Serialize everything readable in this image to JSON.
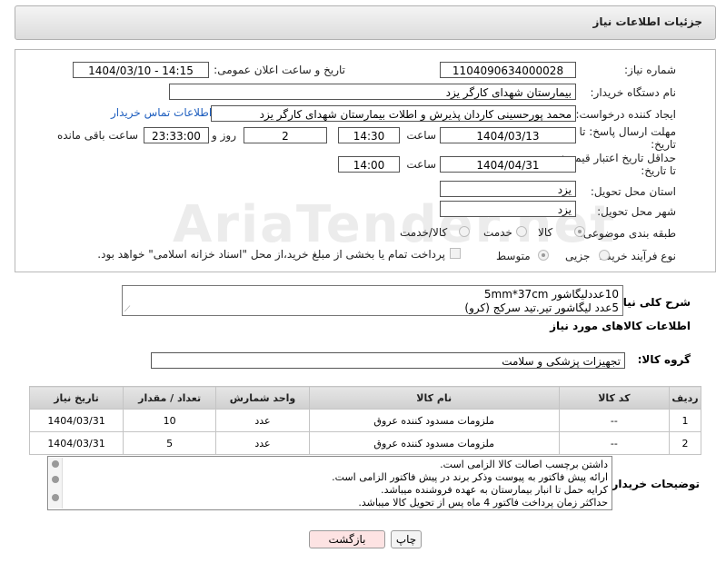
{
  "header": {
    "title": "جزئیات اطلاعات نیاز"
  },
  "watermark": {
    "text": "AriaTender.net"
  },
  "fields": {
    "need_number": {
      "label": "شماره نیاز:",
      "value": "1104090634000028"
    },
    "announce": {
      "label": "تاریخ و ساعت اعلان عمومی:",
      "value": "1404/03/10 - 14:15"
    },
    "buyer_org": {
      "label": "نام دستگاه خریدار:",
      "value": "بیمارستان شهدای کارگر یزد"
    },
    "requester": {
      "label": "ایجاد کننده درخواست:",
      "value": "محمد پورحسینی کاردان پذیرش و اطلات بیمارستان شهدای کارگر یزد",
      "contact_link": "اطلاعات تماس خریدار"
    },
    "reply_deadline": {
      "label_line1": "مهلت ارسال پاسخ: تا",
      "label_line2": "تاریخ:",
      "date": "1404/03/13",
      "time_label": "ساعت",
      "time": "14:30",
      "days": "2",
      "days_label": "روز و",
      "remaining": "23:33:00",
      "remaining_label": "ساعت باقی مانده"
    },
    "price_validity": {
      "label_line1": "حداقل تاریخ اعتبار قیمت:",
      "label_line2": "تا تاریخ:",
      "date": "1404/04/31",
      "time_label": "ساعت",
      "time": "14:00"
    },
    "delivery_province": {
      "label": "استان محل تحویل:",
      "value": "یزد"
    },
    "delivery_city": {
      "label": "شهر محل تحویل:",
      "value": "یزد"
    },
    "category": {
      "label": "طبقه بندی موضوعی:",
      "options": [
        "کالا",
        "خدمت",
        "کالا/خدمت"
      ],
      "selected": "کالا"
    },
    "process": {
      "label": "نوع فرآیند خرید :",
      "options": [
        "جزیی",
        "متوسط"
      ],
      "selected": "متوسط",
      "payment_note": "پرداخت تمام یا بخشی از مبلغ خرید،از محل \"اسناد خزانه اسلامی\" خواهد بود."
    }
  },
  "summary": {
    "label": "شرح کلی نیاز:",
    "line1": "10عددلیگاشور 5mm*37cm",
    "line2": "5عدد لیگاشور تیر.تید سرکج (کرو)"
  },
  "goods_section": {
    "title": "اطلاعات کالاهای مورد نیاز",
    "group_label": "گروه کالا:",
    "group_value": "تجهیزات پزشکی و سلامت"
  },
  "table": {
    "headers": [
      "ردیف",
      "کد کالا",
      "نام کالا",
      "واحد شمارش",
      "تعداد / مقدار",
      "تاریخ نیاز"
    ],
    "rows": [
      [
        "1",
        "--",
        "ملزومات مسدود کننده عروق",
        "عدد",
        "10",
        "1404/03/31"
      ],
      [
        "2",
        "--",
        "ملزومات مسدود کننده عروق",
        "عدد",
        "5",
        "1404/03/31"
      ]
    ]
  },
  "buyer_notes": {
    "label": "توضیحات خریدار:",
    "lines": [
      "داشتن برچسب اصالت کالا الزامی است.",
      "ارائه پیش فاکتور به پیوست وذکر برند در پیش فاکتور الزامی است.",
      "کرایه حمل تا انبار بیمارستان به عهده فروشنده میباشد.",
      "حداکثر زمان پرداخت فاکتور 4 ماه پس از تحویل کالا میباشد."
    ]
  },
  "buttons": {
    "print": "چاپ",
    "back": "بازگشت"
  },
  "colors": {
    "link": "#1f5fbf",
    "back_button_bg": "#fde3e3",
    "header_bg": "#dcdcdc"
  }
}
